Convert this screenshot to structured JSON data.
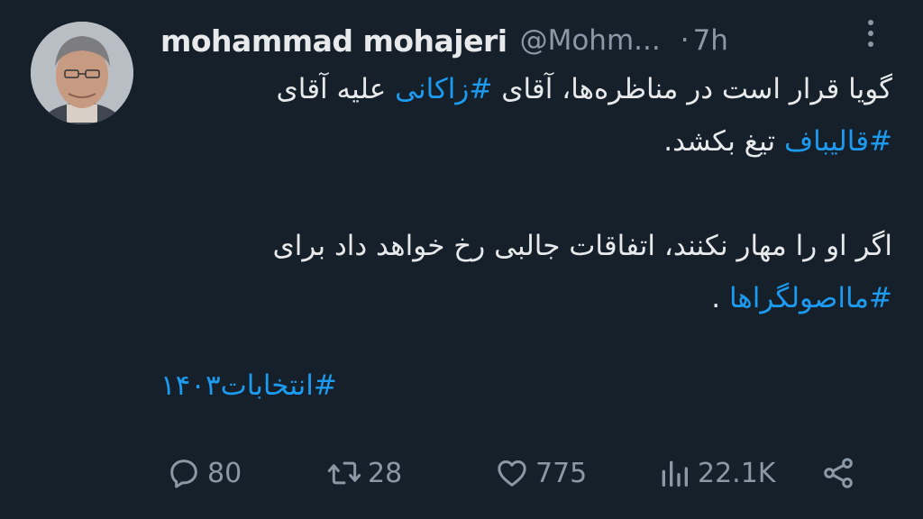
{
  "author": {
    "name": "mohammad mohajeri",
    "handle": "@Mohm...",
    "time": "7h"
  },
  "tweet": {
    "line1": "گویا قرار است در مناظره‌ها، آقای ",
    "tag_zakani": "#زاکانی",
    "line1_end": " علیه آقای",
    "tag_ghalibaf": "#قالیباف",
    "line2_end": " تیغ بکشد.",
    "line3": "اگر او را مهار نکنند، اتفاقات جالبی رخ خواهد داد برای",
    "tag_maasoolgaraha": "#مااصولگراها",
    "line4_end": " .",
    "tag_elections": "#انتخابات۱۴۰۳"
  },
  "actions": {
    "replies": "80",
    "retweets": "28",
    "likes": "775",
    "views": "22.1K"
  },
  "colors": {
    "background": "#15202b",
    "text": "#e7e9ea",
    "secondary": "#8b98a5",
    "link": "#1d9bf0"
  }
}
